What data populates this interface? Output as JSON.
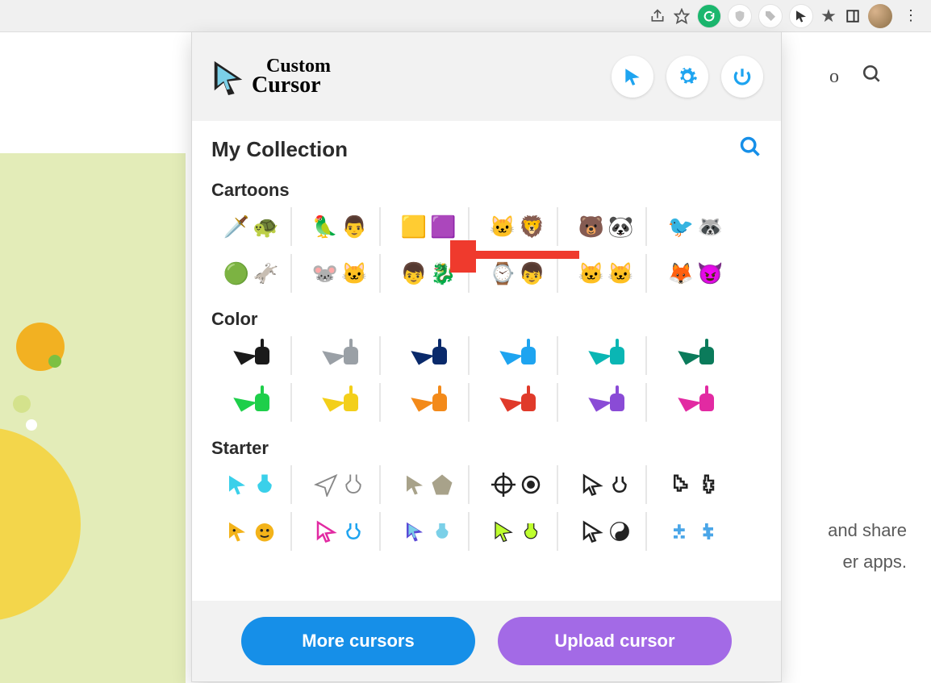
{
  "browser": {
    "extensions": [
      "grammarly-icon",
      "shield-icon",
      "tag-icon",
      "cursor-icon",
      "puzzle-icon",
      "panel-icon"
    ],
    "addrbar_icons": [
      "share-icon",
      "star-icon"
    ]
  },
  "page_bg": {
    "letter": "o",
    "text_right_1": "and share",
    "text_right_2": "er apps."
  },
  "popup": {
    "logo_top": "Custom",
    "logo_bottom": "Cursor",
    "collection_title": "My Collection",
    "categories": [
      {
        "name": "Cartoons",
        "rows": [
          [
            {
              "name": "tmnt",
              "a": "🗡️",
              "b": "🐢"
            },
            {
              "name": "popeye",
              "a": "🦜",
              "b": "👨"
            },
            {
              "name": "minion",
              "a": "🟨",
              "b": "🟪"
            },
            {
              "name": "felix",
              "a": "🐱",
              "b": "🦁"
            },
            {
              "name": "bears",
              "a": "🐻",
              "b": "🐼"
            },
            {
              "name": "regular",
              "a": "🐦",
              "b": "🦝"
            }
          ],
          [
            {
              "name": "shrek",
              "a": "🟢",
              "b": "🫏"
            },
            {
              "name": "tomjerry",
              "a": "🐭",
              "b": "🐱"
            },
            {
              "name": "httyd",
              "a": "👦",
              "b": "🐉"
            },
            {
              "name": "ben10",
              "a": "⌚",
              "b": "👦"
            },
            {
              "name": "garfield",
              "a": "🐱",
              "b": "🐱"
            },
            {
              "name": "grinch",
              "a": "🦊",
              "b": "😈"
            }
          ]
        ]
      },
      {
        "name": "Color",
        "rows": [
          [
            {
              "name": "black",
              "c": "#1a1a1a"
            },
            {
              "name": "gray",
              "c": "#9aa0a6"
            },
            {
              "name": "navy",
              "c": "#0a2a6b"
            },
            {
              "name": "blue",
              "c": "#1ea4f0"
            },
            {
              "name": "teal",
              "c": "#0ab6b4"
            },
            {
              "name": "dgreen",
              "c": "#0b7b5b"
            }
          ],
          [
            {
              "name": "green",
              "c": "#1ecf4a"
            },
            {
              "name": "yellow",
              "c": "#f3cf1a"
            },
            {
              "name": "orange",
              "c": "#f38a1a"
            },
            {
              "name": "red",
              "c": "#e03a2a"
            },
            {
              "name": "purple",
              "c": "#8a4bd6"
            },
            {
              "name": "magenta",
              "c": "#e22aa2"
            }
          ]
        ]
      },
      {
        "name": "Starter",
        "rows": [
          [
            {
              "name": "aqua",
              "kind": "s"
            },
            {
              "name": "paper",
              "kind": "s"
            },
            {
              "name": "stone",
              "kind": "s"
            },
            {
              "name": "crosshair",
              "kind": "s"
            },
            {
              "name": "outline",
              "kind": "s"
            },
            {
              "name": "pixel",
              "kind": "s"
            }
          ],
          [
            {
              "name": "emoji",
              "kind": "s"
            },
            {
              "name": "rainbow",
              "kind": "s"
            },
            {
              "name": "stripe",
              "kind": "s"
            },
            {
              "name": "neon",
              "kind": "s"
            },
            {
              "name": "yinyang",
              "kind": "s"
            },
            {
              "name": "pixblue",
              "kind": "s"
            }
          ]
        ]
      }
    ],
    "footer": {
      "more": "More cursors",
      "upload": "Upload cursor"
    }
  }
}
